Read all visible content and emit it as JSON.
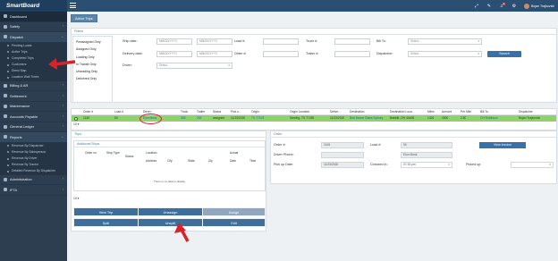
{
  "app": {
    "brand": "SmartBoard",
    "user_name": "Bojan Trajkovski",
    "notif_count": "1"
  },
  "sidebar": {
    "items": [
      {
        "label": "Dashboard",
        "state": "active"
      },
      {
        "label": "Safety",
        "state": ""
      },
      {
        "label": "Dispatch",
        "state": "open"
      },
      {
        "label": "Billing & AR",
        "state": ""
      },
      {
        "label": "Settlement",
        "state": ""
      },
      {
        "label": "Maintenance",
        "state": ""
      },
      {
        "label": "Accounts Payable",
        "state": ""
      },
      {
        "label": "General Ledger",
        "state": ""
      },
      {
        "label": "Reports",
        "state": "open"
      },
      {
        "label": "Administration",
        "state": ""
      },
      {
        "label": "IFTA",
        "state": ""
      }
    ],
    "dispatch_sub": [
      "Pending Loads",
      "Active Trips",
      "Completed Trips",
      "Customers",
      "Direct Map",
      "Location Wait Times"
    ],
    "reports_sub": [
      "Revenue By Dispatcher",
      "Revenue By Salesperson",
      "Revenue By Driver",
      "Revenue By Tractor",
      "Detailed Revenue By Dispatcher"
    ]
  },
  "tab": {
    "label": "Active Trips"
  },
  "filters": {
    "title": "Filters",
    "statuses": [
      "Preassigned Only",
      "Assigned Only",
      "Loading Only",
      "In Transit Only",
      "Unloading Only",
      "Delivered Only"
    ],
    "ship_date_label": "Ship date:",
    "delivery_date_label": "Delivery date:",
    "driver_label": "Driver:",
    "load_label": "Load #:",
    "order_label": "Order #:",
    "truck_label": "Truck #:",
    "trailer_label": "Trailer #:",
    "bill_to_label": "Bill To:",
    "dispatcher_label": "Dispatcher:",
    "date_placeholder": "MM/DD/YYYY",
    "select_placeholder": "Select...",
    "search_button": "Search"
  },
  "grid": {
    "headers": [
      "Order #",
      "Load #",
      "Driver",
      "Truck",
      "Trailer",
      "Status",
      "Pick u...",
      "Origin",
      "Origin Location",
      "Delive...",
      "Destination",
      "Destination Loca...",
      "Miles",
      "Amount",
      "Per Mile",
      "Bill To",
      "Dispatcher"
    ],
    "row": [
      "1145",
      "50",
      "Elon Musk",
      "303",
      "202",
      "assigned",
      "11/23/2020",
      "TX 77478",
      "Sterling, TX 77459",
      "11/23/2020",
      "Bob Moore Glass Sydney",
      "Babbitt, OH 44408",
      "1426",
      "4000",
      "2.80",
      "CH Robinson",
      "Bojan Trajkovski"
    ],
    "page_size": "10"
  },
  "trips": {
    "title": "Trips",
    "stops_title": "Additional Stops",
    "headers": [
      "Order no",
      "Stop Type",
      "Status",
      "Location",
      "Address",
      "City",
      "State",
      "Zip",
      "Actual",
      "Date",
      "Time"
    ],
    "no_data": "There is no data to display",
    "page_size": "10",
    "buttons": [
      "View Trip",
      "Unassign",
      "Assign",
      "Split",
      "Unsplit",
      "Edit"
    ]
  },
  "order": {
    "title": "Order",
    "order_label": "Order #:",
    "order_value": "1145",
    "load_label": "Load #:",
    "load_value": "50",
    "driver_phone_label": "Driver Phone:",
    "driver_name": "Elon Musk",
    "pickup_date_label": "Pick up Date:",
    "pickup_date_value": "11/23/2020",
    "checked_in_label": "Checked in:",
    "checked_in_value": "07:15 pm",
    "picked_up_label": "Picked up:",
    "invoice_button": "View invoice"
  },
  "colors": {
    "selected_row": "#8fd26a",
    "annotation": "#d8232a",
    "primary": "#3a70a8"
  }
}
